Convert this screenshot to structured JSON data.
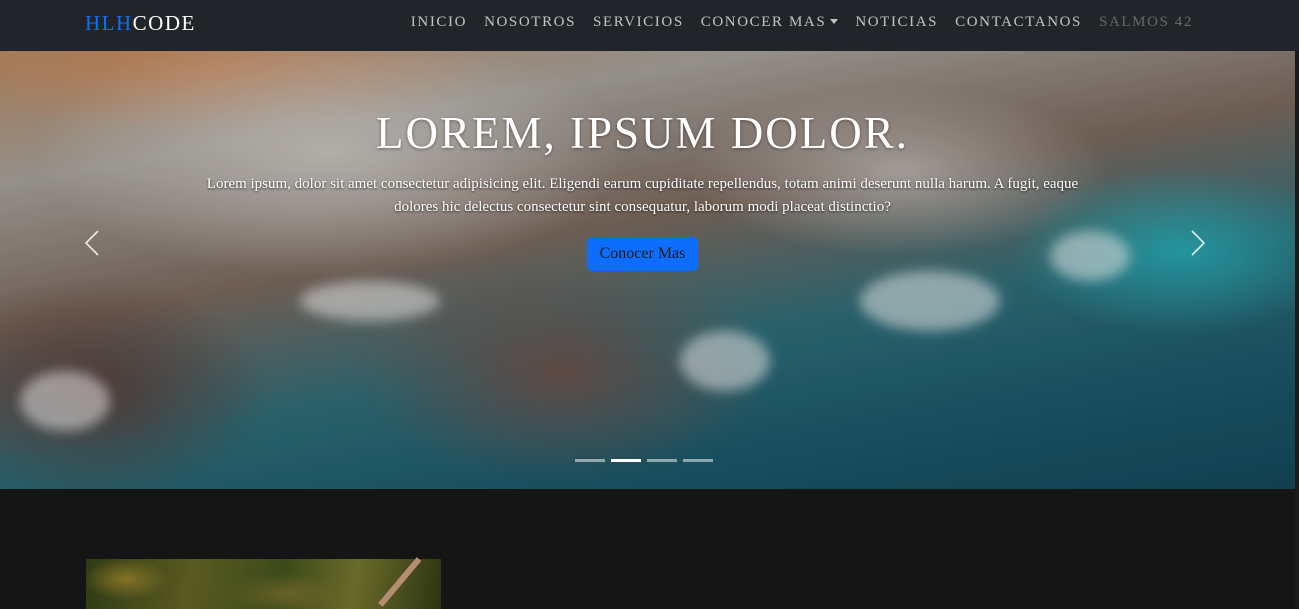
{
  "brand": {
    "part1": "HLH",
    "part2": "CODE"
  },
  "nav": {
    "items": [
      {
        "label": "INICIO"
      },
      {
        "label": "NOSOTROS"
      },
      {
        "label": "SERVICIOS"
      },
      {
        "label": "CONOCER MAS",
        "dropdown": true
      },
      {
        "label": "NOTICIAS"
      },
      {
        "label": "CONTACTANOS"
      },
      {
        "label": "SALMOS 42",
        "disabled": true
      }
    ]
  },
  "hero": {
    "title": "LOREM, IPSUM DOLOR.",
    "text": "Lorem ipsum, dolor sit amet consectetur adipisicing elit. Eligendi earum cupiditate repellendus, totam animi deserunt nulla harum. A fugit, eaque dolores hic delectus consectetur sint consequatur, laborum modi placeat distinctio?",
    "button_label": "Conocer Mas",
    "slides": 4,
    "active_slide": 2
  },
  "icons": {
    "prev": "chevron-left-icon",
    "next": "chevron-right-icon",
    "dropdown": "caret-down-icon"
  },
  "colors": {
    "navbar_bg": "#212529",
    "brand_accent": "#0d6efd",
    "button_bg": "#0d6efd",
    "page_bg": "#141514"
  }
}
